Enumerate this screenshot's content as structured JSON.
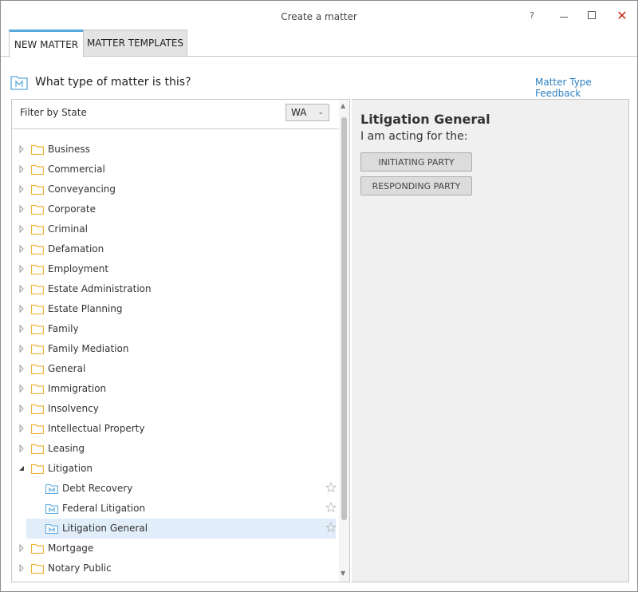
{
  "window": {
    "title": "Create a matter",
    "help_label": "?",
    "close_label": "✕"
  },
  "tabs": [
    {
      "label": "NEW MATTER",
      "active": true
    },
    {
      "label": "MATTER TEMPLATES",
      "active": false
    }
  ],
  "header": {
    "question": "What type of matter is this?",
    "feedback_link": "Matter Type Feedback",
    "icon": "matter-icon"
  },
  "filter": {
    "label": "Filter by State",
    "selected_state": "WA"
  },
  "tree": {
    "items": [
      {
        "label": "Business",
        "type": "folder",
        "expanded": false
      },
      {
        "label": "Commercial",
        "type": "folder",
        "expanded": false
      },
      {
        "label": "Conveyancing",
        "type": "folder",
        "expanded": false
      },
      {
        "label": "Corporate",
        "type": "folder",
        "expanded": false
      },
      {
        "label": "Criminal",
        "type": "folder",
        "expanded": false
      },
      {
        "label": "Defamation",
        "type": "folder",
        "expanded": false
      },
      {
        "label": "Employment",
        "type": "folder",
        "expanded": false
      },
      {
        "label": "Estate Administration",
        "type": "folder",
        "expanded": false
      },
      {
        "label": "Estate Planning",
        "type": "folder",
        "expanded": false
      },
      {
        "label": "Family",
        "type": "folder",
        "expanded": false
      },
      {
        "label": "Family Mediation",
        "type": "folder",
        "expanded": false
      },
      {
        "label": "General",
        "type": "folder",
        "expanded": false
      },
      {
        "label": "Immigration",
        "type": "folder",
        "expanded": false
      },
      {
        "label": "Insolvency",
        "type": "folder",
        "expanded": false
      },
      {
        "label": "Intellectual Property",
        "type": "folder",
        "expanded": false
      },
      {
        "label": "Leasing",
        "type": "folder",
        "expanded": false
      },
      {
        "label": "Litigation",
        "type": "folder",
        "expanded": true
      },
      {
        "label": "Debt Recovery",
        "type": "matter",
        "selected": false
      },
      {
        "label": "Federal Litigation",
        "type": "matter",
        "selected": false
      },
      {
        "label": "Litigation General",
        "type": "matter",
        "selected": true
      },
      {
        "label": "Mortgage",
        "type": "folder",
        "expanded": false
      },
      {
        "label": "Notary Public",
        "type": "folder",
        "expanded": false
      }
    ]
  },
  "detail": {
    "title": "Litigation General",
    "subtitle": "I am acting for the:",
    "buttons": [
      "INITIATING PARTY",
      "RESPONDING PARTY"
    ]
  },
  "colors": {
    "accent": "#5aa9dc",
    "link": "#2f80c0",
    "folder": "#f0b43c",
    "selected_row": "#e1edf9",
    "close": "#c42b1c"
  }
}
